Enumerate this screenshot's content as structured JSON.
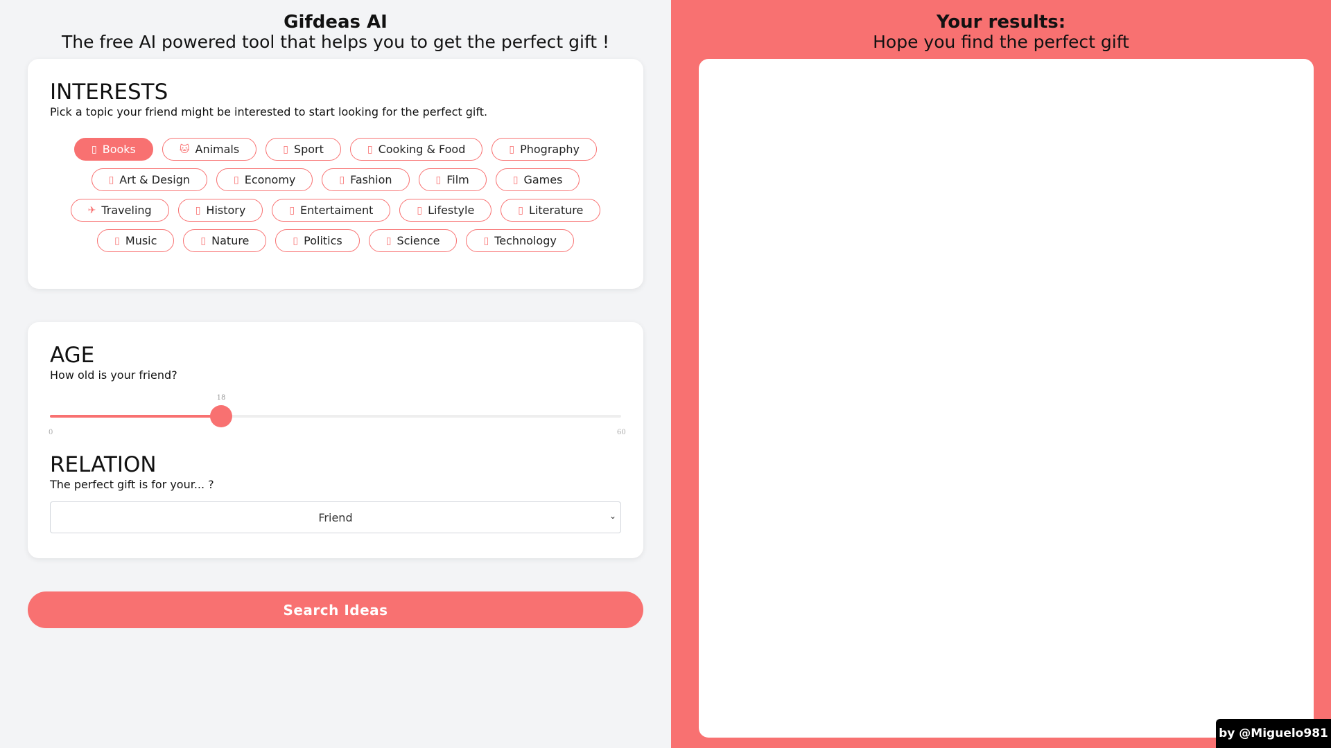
{
  "colors": {
    "accent": "#f87171",
    "left_bg": "#f3f4f6",
    "card_bg": "#ffffff",
    "credit_bg": "#000000"
  },
  "header": {
    "title": "Gifdeas AI",
    "subtitle": "The free AI powered tool that helps you to get the perfect gift !"
  },
  "interests": {
    "title": "INTERESTS",
    "description": "Pick a topic your friend might be interested to start looking for the perfect gift.",
    "rows": [
      [
        {
          "label": "Books",
          "icon": "book-icon",
          "glyph": "▯",
          "active": true
        },
        {
          "label": "Animals",
          "icon": "cat-icon",
          "glyph": "🐱",
          "active": false
        },
        {
          "label": "Sport",
          "icon": "sport-icon",
          "glyph": "▯",
          "active": false
        },
        {
          "label": "Cooking & Food",
          "icon": "food-icon",
          "glyph": "▯",
          "active": false
        },
        {
          "label": "Phography",
          "icon": "camera-icon",
          "glyph": "▯",
          "active": false
        }
      ],
      [
        {
          "label": "Art & Design",
          "icon": "art-icon",
          "glyph": "▯",
          "active": false
        },
        {
          "label": "Economy",
          "icon": "money-icon",
          "glyph": "▯",
          "active": false
        },
        {
          "label": "Fashion",
          "icon": "fashion-icon",
          "glyph": "▯",
          "active": false
        },
        {
          "label": "Film",
          "icon": "film-icon",
          "glyph": "▯",
          "active": false
        },
        {
          "label": "Games",
          "icon": "games-icon",
          "glyph": "▯",
          "active": false
        }
      ],
      [
        {
          "label": "Traveling",
          "icon": "airplane-icon",
          "glyph": "✈",
          "active": false
        },
        {
          "label": "History",
          "icon": "history-icon",
          "glyph": "▯",
          "active": false
        },
        {
          "label": "Entertaiment",
          "icon": "entertainment-icon",
          "glyph": "▯",
          "active": false
        },
        {
          "label": "Lifestyle",
          "icon": "lifestyle-icon",
          "glyph": "▯",
          "active": false
        },
        {
          "label": "Literature",
          "icon": "literature-icon",
          "glyph": "▯",
          "active": false
        }
      ],
      [
        {
          "label": "Music",
          "icon": "music-icon",
          "glyph": "▯",
          "active": false
        },
        {
          "label": "Nature",
          "icon": "nature-icon",
          "glyph": "▯",
          "active": false
        },
        {
          "label": "Politics",
          "icon": "politics-icon",
          "glyph": "▯",
          "active": false
        },
        {
          "label": "Science",
          "icon": "science-icon",
          "glyph": "▯",
          "active": false
        },
        {
          "label": "Technology",
          "icon": "technology-icon",
          "glyph": "▯",
          "active": false
        }
      ]
    ]
  },
  "age": {
    "title": "AGE",
    "description": "How old is your friend?",
    "value": 18,
    "value_label": "18",
    "min": 0,
    "max": 60,
    "min_label": "0",
    "max_label": "60"
  },
  "relation": {
    "title": "RELATION",
    "description": "The perfect gift is for your... ?",
    "selected": "Friend"
  },
  "search_button": {
    "label": "Search Ideas"
  },
  "results": {
    "title": "Your results:",
    "subtitle": "Hope you find the perfect gift"
  },
  "credit": {
    "label": "by @Miguelo981"
  }
}
